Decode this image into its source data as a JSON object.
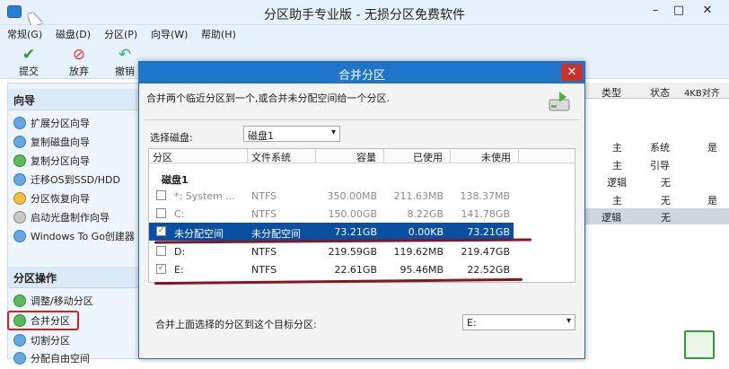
{
  "window": {
    "title": "分区助手专业版 - 无损分区免费软件",
    "minimize": "–",
    "maximize": "□",
    "close": "✕"
  },
  "menu": [
    "常规(G)",
    "磁盘(D)",
    "分区(P)",
    "向导(W)",
    "帮助(H)"
  ],
  "toolbar": [
    {
      "label": "提交",
      "icon": "check-icon",
      "color": "#2e9a2e"
    },
    {
      "label": "放弃",
      "icon": "discard-icon",
      "color": "#d33"
    },
    {
      "label": "撤销",
      "icon": "undo-icon",
      "color": "#3a7"
    }
  ],
  "sidebar": {
    "wizard_title": "向导",
    "wizard_items": [
      "扩展分区向导",
      "复制磁盘向导",
      "复制分区向导",
      "迁移OS到SSD/HDD",
      "分区恢复向导",
      "启动光盘制作向导",
      "Windows To Go创建器"
    ],
    "ops_title": "分区操作",
    "ops_items": [
      "调整/移动分区",
      "合并分区",
      "切割分区",
      "分配自由空间"
    ]
  },
  "right": {
    "headers": [
      "类型",
      "状态",
      "4KB对齐"
    ],
    "rows": [
      {
        "type": "主",
        "status": "系统",
        "align": "是"
      },
      {
        "type": "主",
        "status": "引导",
        "align": ""
      },
      {
        "type": "逻辑",
        "status": "无",
        "align": ""
      },
      {
        "type": "主",
        "status": "无",
        "align": "是"
      },
      {
        "type": "逻辑",
        "status": "无",
        "align": ""
      }
    ]
  },
  "dialog": {
    "title": "合并分区",
    "close": "✕",
    "desc": "合并两个临近分区到一个,或合并未分配空间给一个分区.",
    "select_disk_label": "选择磁盘:",
    "select_disk_value": "磁盘1",
    "columns": [
      "分区",
      "文件系统",
      "容量",
      "已使用",
      "未使用"
    ],
    "disk_name": "磁盘1",
    "rows": [
      {
        "checked": false,
        "name": "*: System ...",
        "fs": "NTFS",
        "cap": "350.00MB",
        "used": "211.63MB",
        "free": "138.37MB",
        "state": "grey"
      },
      {
        "checked": false,
        "name": "C:",
        "fs": "NTFS",
        "cap": "150.00GB",
        "used": "8.22GB",
        "free": "141.78GB",
        "state": "grey"
      },
      {
        "checked": true,
        "name": "未分配空间",
        "fs": "未分配空间",
        "cap": "73.21GB",
        "used": "0.00KB",
        "free": "73.21GB",
        "state": "sel"
      },
      {
        "checked": false,
        "name": "D:",
        "fs": "NTFS",
        "cap": "219.59GB",
        "used": "119.62MB",
        "free": "219.47GB",
        "state": "normal"
      },
      {
        "checked": true,
        "name": "E:",
        "fs": "NTFS",
        "cap": "22.61GB",
        "used": "95.46MB",
        "free": "22.52GB",
        "state": "normal"
      }
    ],
    "target_label": "合并上面选择的分区到这个目标分区:",
    "target_value": "E:"
  }
}
